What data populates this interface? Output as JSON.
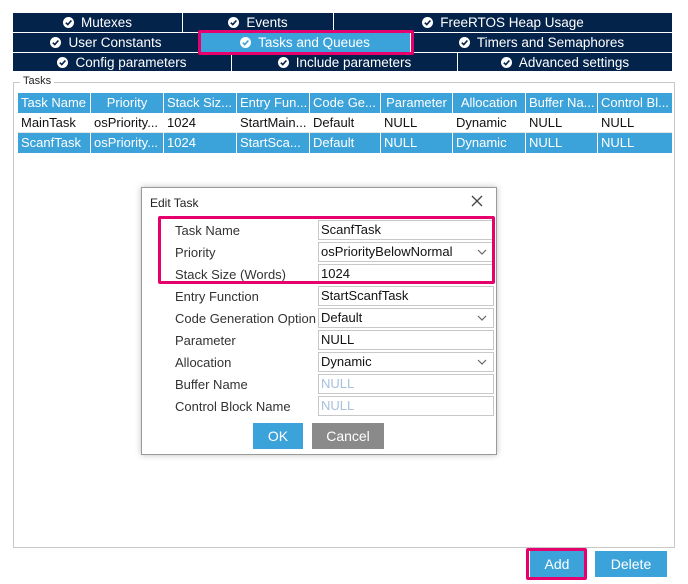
{
  "tabs": {
    "row1": [
      {
        "label": "Mutexes"
      },
      {
        "label": "Events"
      },
      {
        "label": "FreeRTOS Heap Usage"
      }
    ],
    "row2": [
      {
        "label": "User Constants"
      },
      {
        "label": "Tasks and Queues"
      },
      {
        "label": "Timers and Semaphores"
      }
    ],
    "row3": [
      {
        "label": "Config parameters"
      },
      {
        "label": "Include parameters"
      },
      {
        "label": "Advanced settings"
      }
    ],
    "active": "Tasks and Queues"
  },
  "tasks": {
    "group_title": "Tasks",
    "columns": [
      "Task Name",
      "Priority",
      "Stack Siz...",
      "Entry Fun...",
      "Code Ge...",
      "Parameter",
      "Allocation",
      "Buffer Na...",
      "Control Bl..."
    ],
    "rows": [
      [
        "MainTask",
        "osPriority...",
        "1024",
        "StartMain...",
        "Default",
        "NULL",
        "Dynamic",
        "NULL",
        "NULL"
      ],
      [
        "ScanfTask",
        "osPriority...",
        "1024",
        "StartSca...",
        "Default",
        "NULL",
        "Dynamic",
        "NULL",
        "NULL"
      ]
    ],
    "selected_row": 1
  },
  "dialog": {
    "title": "Edit Task",
    "fields": [
      {
        "label": "Task Name",
        "value": "ScanfTask",
        "type": "text"
      },
      {
        "label": "Priority",
        "value": "osPriorityBelowNormal",
        "type": "select"
      },
      {
        "label": "Stack Size (Words)",
        "value": "1024",
        "type": "text"
      },
      {
        "label": "Entry Function",
        "value": "StartScanfTask",
        "type": "text"
      },
      {
        "label": "Code Generation Option",
        "value": "Default",
        "type": "select"
      },
      {
        "label": "Parameter",
        "value": "NULL",
        "type": "text"
      },
      {
        "label": "Allocation",
        "value": "Dynamic",
        "type": "select"
      },
      {
        "label": "Buffer Name",
        "placeholder": "NULL",
        "type": "text"
      },
      {
        "label": "Control Block Name",
        "placeholder": "NULL",
        "type": "text"
      }
    ],
    "ok_label": "OK",
    "cancel_label": "Cancel"
  },
  "buttons": {
    "add_label": "Add",
    "delete_label": "Delete"
  },
  "colors": {
    "tabbar": "#03234b",
    "accent": "#3ca3da",
    "highlight": "#e5006d",
    "cancel": "#8a8a8a"
  },
  "icons": {
    "tab": "check-circle-icon",
    "close": "close-icon",
    "dropdown": "chevron-down-icon"
  }
}
